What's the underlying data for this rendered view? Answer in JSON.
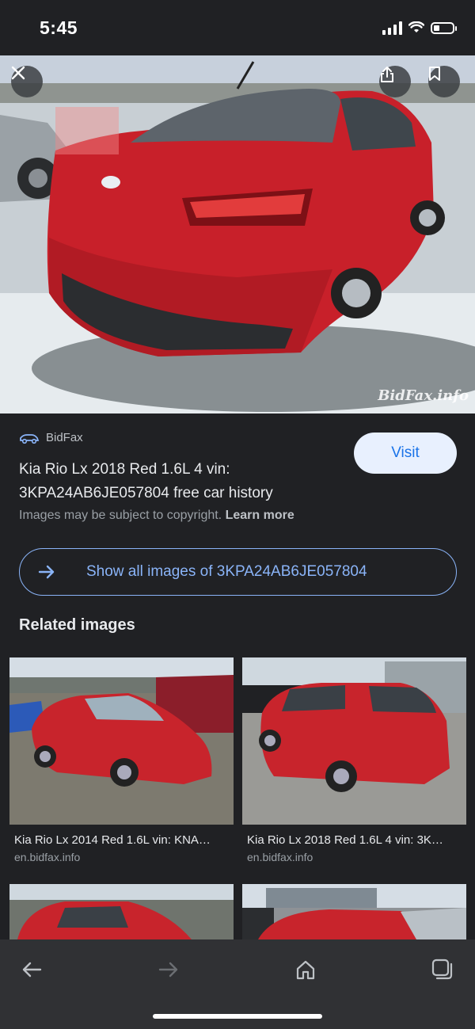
{
  "status_bar": {
    "time": "5:45"
  },
  "hero": {
    "watermark": "BidFax.info",
    "close_icon": "close-icon",
    "share_icon": "share-icon",
    "bookmark_icon": "bookmark-icon"
  },
  "result": {
    "source_name": "BidFax",
    "source_icon": "car-icon",
    "title": "Kia Rio Lx 2018 Red 1.6L 4 vin: 3KPA24AB6JE057804 free car history",
    "visit_label": "Visit",
    "copyright_text": "Images may be subject to copyright.",
    "learn_more": "Learn more",
    "show_all_label": "Show all images of 3KPA24AB6JE057804"
  },
  "related": {
    "heading": "Related images",
    "items": [
      {
        "caption": "Kia Rio Lx 2014 Red 1.6L vin: KNA…",
        "domain": "en.bidfax.info"
      },
      {
        "caption": "Kia Rio Lx 2018 Red 1.6L 4 vin: 3K…",
        "domain": "en.bidfax.info"
      }
    ]
  },
  "toolbar": {
    "back_icon": "back-arrow-icon",
    "forward_icon": "forward-arrow-icon",
    "home_icon": "home-icon",
    "tabs_icon": "tabs-icon"
  },
  "colors": {
    "background": "#202124",
    "accent": "#8ab4f8",
    "visit_bg": "#e8f0fe",
    "visit_text": "#1a73e8"
  }
}
